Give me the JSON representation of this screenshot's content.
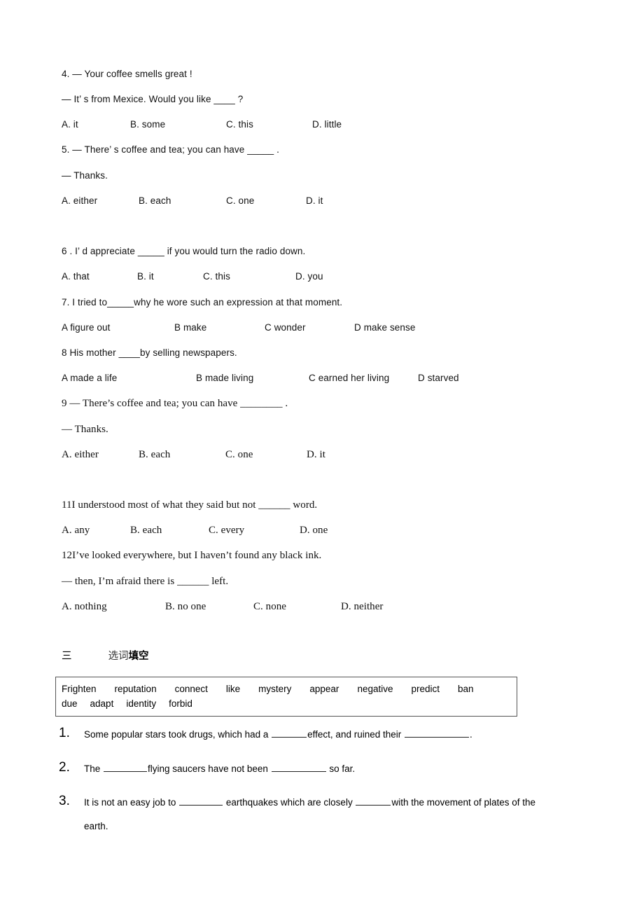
{
  "document": {
    "questions": [
      {
        "id": "q4",
        "lines": [
          "4. — Your coffee smells great !",
          "— It’ s from Mexice. Would you like ____ ?"
        ],
        "options": [
          "A. it",
          "B. some",
          "C. this",
          "D. little"
        ]
      },
      {
        "id": "q5",
        "lines": [
          "5. — There’ s coffee and tea; you can have _____ .",
          "— Thanks."
        ],
        "options": [
          "A. either",
          "B. each",
          "C. one",
          "D. it"
        ]
      },
      {
        "id": "q6",
        "lines": [
          "6 . I’ d appreciate _____ if you would turn the radio down."
        ],
        "options": [
          "A. that",
          "B. it",
          "C. this",
          "D. you"
        ]
      },
      {
        "id": "q7",
        "lines": [
          "7. I tried to_____why he wore such an expression at that moment."
        ],
        "options": [
          "A  figure out",
          "B make",
          "C wonder",
          "D make sense"
        ]
      },
      {
        "id": "q8",
        "lines": [
          "8  His mother ____by selling newspapers."
        ],
        "options": [
          "A  made a life",
          "B made   living",
          "C earned her living",
          "D starved"
        ]
      },
      {
        "id": "q9",
        "lines": [
          "9 — There’s coffee and tea; you can have ________ .",
          "— Thanks."
        ],
        "options": [
          "A. either",
          "B. each",
          "C. one",
          "D. it"
        ]
      },
      {
        "id": "q11",
        "lines": [
          "11I understood most of what they said but not ______ word."
        ],
        "options": [
          "A. any",
          "B. each",
          "C. every",
          "D. one"
        ]
      },
      {
        "id": "q12",
        "lines": [
          "12I’ve looked everywhere, but I haven’t found any black ink.",
          "— then, I’m afraid there is ______ left."
        ],
        "options": [
          "A. nothing",
          "B. no one",
          "C. none",
          "D. neither"
        ]
      }
    ],
    "section_three": {
      "number": "三",
      "title_light": "选词",
      "title_bold": "填空",
      "word_bank": {
        "row1": [
          "Frighten",
          "reputation",
          "connect",
          "like",
          "mystery",
          "appear",
          "negative",
          "predict",
          "ban"
        ],
        "row2": [
          "due",
          "adapt",
          "identity",
          "forbid"
        ]
      },
      "items": [
        {
          "number": "1.",
          "text_parts": [
            "Some popular stars   took drugs, which had a ",
            "effect, and ruined their ",
            "."
          ],
          "continuation": ""
        },
        {
          "number": "2.",
          "text_parts": [
            "The ",
            "flying saucers   have not been ",
            " so far."
          ],
          "continuation": ""
        },
        {
          "number": "3.",
          "text_parts": [
            "It is not an easy job to ",
            " earthquakes which are closely ",
            "with the movement of plates of the"
          ],
          "continuation": "earth."
        }
      ]
    }
  }
}
